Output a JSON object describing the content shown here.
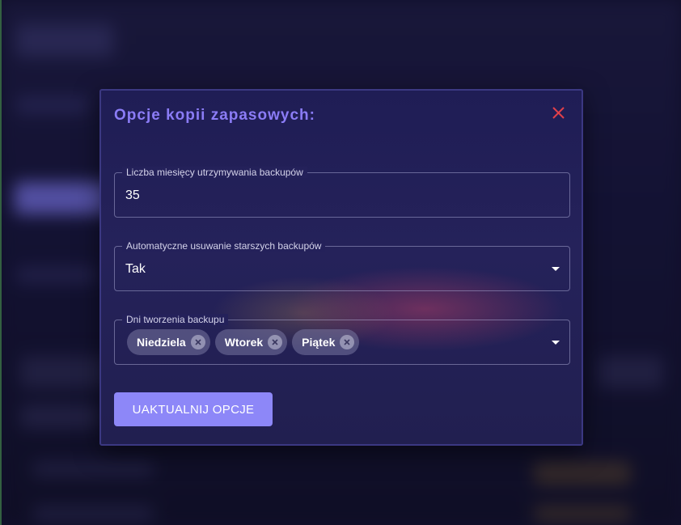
{
  "modal": {
    "title": "Opcje kopii zapasowych:",
    "close_icon": "close-icon",
    "close_color": "#e0404a",
    "accent_color": "#8b7cf6",
    "button_color": "#8d87f8"
  },
  "fields": {
    "retention": {
      "label": "Liczba miesięcy utrzymywania backupów",
      "value": "35"
    },
    "auto_delete": {
      "label": "Automatyczne usuwanie starszych backupów",
      "value": "Tak"
    },
    "backup_days": {
      "label": "Dni tworzenia backupu",
      "chips": [
        "Niedziela",
        "Wtorek",
        "Piątek"
      ]
    }
  },
  "update_button": {
    "label": "UAKTUALNIJ OPCJE"
  }
}
